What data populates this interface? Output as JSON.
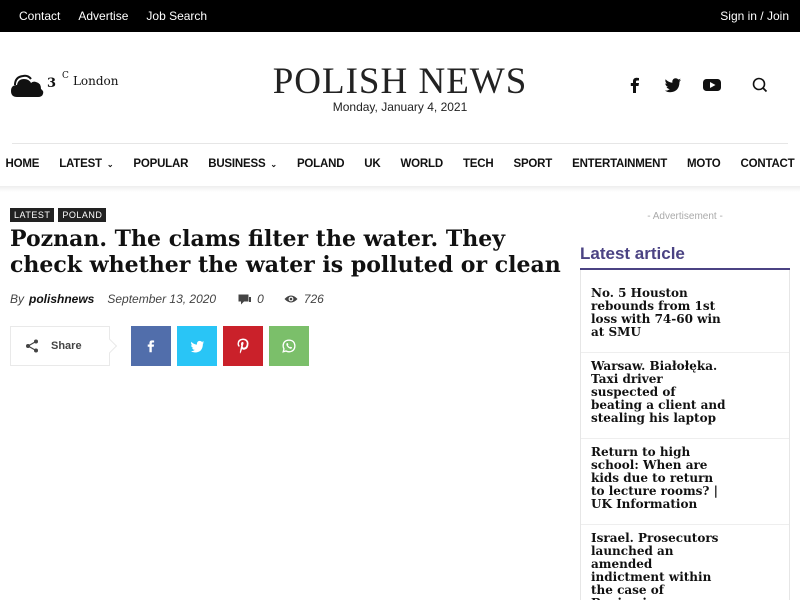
{
  "topbar": {
    "links": [
      "Contact",
      "Advertise",
      "Job Search"
    ],
    "signin": "Sign in / Join"
  },
  "weather": {
    "temp": "3",
    "unit": "C",
    "city": "London",
    "icon": "cloud-icon"
  },
  "header": {
    "logo": "POLISH NEWS",
    "date": "Monday, January 4, 2021",
    "social_icons": [
      "facebook-icon",
      "twitter-icon",
      "youtube-icon",
      "search-icon"
    ]
  },
  "nav": {
    "items": [
      {
        "label": "HOME"
      },
      {
        "label": "LATEST",
        "caret": "⌄"
      },
      {
        "label": "POPULAR"
      },
      {
        "label": "BUSINESS",
        "caret": "⌄"
      },
      {
        "label": "POLAND"
      },
      {
        "label": "UK"
      },
      {
        "label": "WORLD"
      },
      {
        "label": "TECH"
      },
      {
        "label": "SPORT"
      },
      {
        "label": "ENTERTAINMENT"
      },
      {
        "label": "MOTO"
      },
      {
        "label": "CONTACT"
      }
    ]
  },
  "article": {
    "tags": [
      "LATEST",
      "POLAND"
    ],
    "title": "Poznan. The clams filter the water. They check whether the water is polluted or clean",
    "by": "By",
    "author": "polishnews",
    "date": "September 13, 2020",
    "comments": "0",
    "views": "726"
  },
  "share": {
    "label": "Share",
    "buttons": [
      {
        "name": "facebook-share-button",
        "color": "#516eab"
      },
      {
        "name": "twitter-share-button",
        "color": "#29c5f6"
      },
      {
        "name": "pinterest-share-button",
        "color": "#ca212a"
      },
      {
        "name": "whatsapp-share-button",
        "color": "#7bbf6a"
      }
    ]
  },
  "sidebar": {
    "advertisement": "- Advertisement -",
    "latest_title": "Latest article",
    "accent": "#4b4383",
    "articles": [
      "No. 5 Houston rebounds from 1st loss with 74-60 win at SMU",
      "Warsaw. Białołęka. Taxi driver suspected of beating a client and stealing his laptop",
      "Return to high school: When are kids due to return to lecture rooms? | UK Information",
      "Israel. Prosecutors launched an amended indictment within the case of Benjamin Netanyahu"
    ]
  }
}
